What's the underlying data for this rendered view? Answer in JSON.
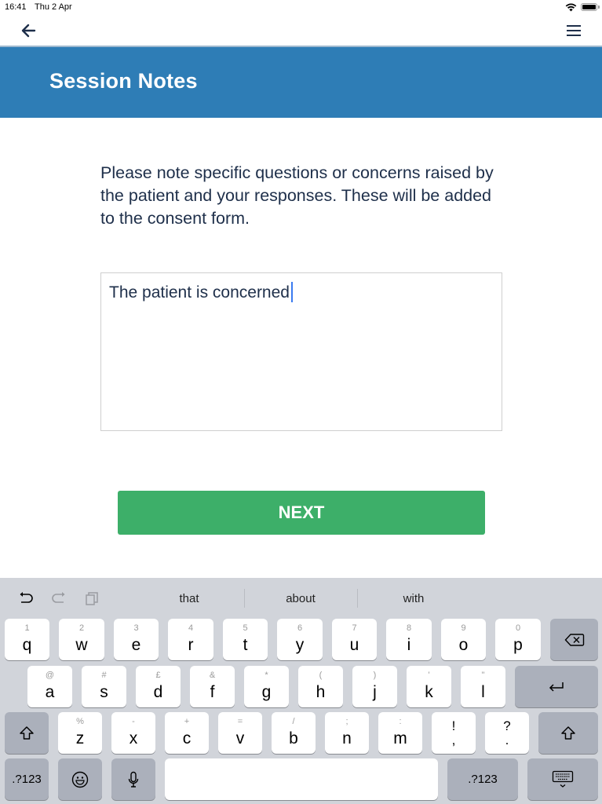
{
  "status_bar": {
    "time": "16:41",
    "date": "Thu 2 Apr",
    "wifi_icon": "wifi-icon",
    "battery_icon": "battery-icon"
  },
  "nav": {
    "back_icon": "arrow-left-icon",
    "menu_icon": "hamburger-menu-icon"
  },
  "header": {
    "title": "Session Notes"
  },
  "main": {
    "instructions": "Please note specific questions or concerns raised by the patient and your responses. These will be added to the consent form.",
    "notes_value": "The patient is concerned",
    "next_label": "NEXT"
  },
  "colors": {
    "header_bg": "#2e7db6",
    "next_bg": "#3daf69",
    "text": "#1e2f4a",
    "caret": "#3b7bf0"
  },
  "keyboard": {
    "toolbar": {
      "undo_icon": "undo-icon",
      "redo_icon": "redo-icon",
      "paste_icon": "paste-icon"
    },
    "suggestions": [
      "that",
      "about",
      "with"
    ],
    "row1": [
      {
        "alt": "1",
        "key": "q"
      },
      {
        "alt": "2",
        "key": "w"
      },
      {
        "alt": "3",
        "key": "e"
      },
      {
        "alt": "4",
        "key": "r"
      },
      {
        "alt": "5",
        "key": "t"
      },
      {
        "alt": "6",
        "key": "y"
      },
      {
        "alt": "7",
        "key": "u"
      },
      {
        "alt": "8",
        "key": "i"
      },
      {
        "alt": "9",
        "key": "o"
      },
      {
        "alt": "0",
        "key": "p"
      }
    ],
    "row2": [
      {
        "alt": "@",
        "key": "a"
      },
      {
        "alt": "#",
        "key": "s"
      },
      {
        "alt": "£",
        "key": "d"
      },
      {
        "alt": "&",
        "key": "f"
      },
      {
        "alt": "*",
        "key": "g"
      },
      {
        "alt": "(",
        "key": "h"
      },
      {
        "alt": ")",
        "key": "j"
      },
      {
        "alt": "'",
        "key": "k"
      },
      {
        "alt": "\"",
        "key": "l"
      }
    ],
    "row3": [
      {
        "alt": "%",
        "key": "z"
      },
      {
        "alt": "-",
        "key": "x"
      },
      {
        "alt": "+",
        "key": "c"
      },
      {
        "alt": "=",
        "key": "v"
      },
      {
        "alt": "/",
        "key": "b"
      },
      {
        "alt": ";",
        "key": "n"
      },
      {
        "alt": ":",
        "key": "m"
      }
    ],
    "row3_punct": [
      {
        "top": "!",
        "bottom": ","
      },
      {
        "top": "?",
        "bottom": "."
      }
    ],
    "numbers_label": ".?123",
    "numbers_label_right": ".?123"
  }
}
